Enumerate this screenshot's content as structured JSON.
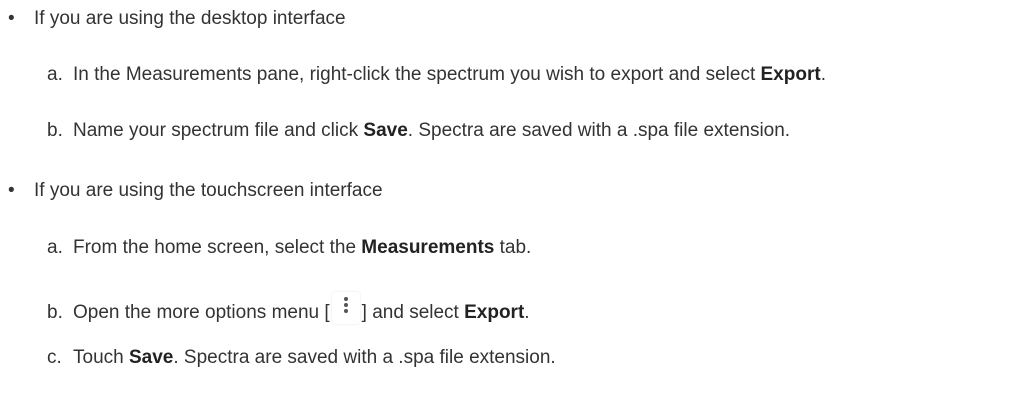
{
  "sections": [
    {
      "bullet": "•",
      "heading": "If you are using the desktop interface",
      "steps": [
        {
          "marker": "a.",
          "pre": "In the Measurements pane, right-click the spectrum you wish to export and select ",
          "bold": "Export",
          "post": "."
        },
        {
          "marker": "b.",
          "pre": "Name your spectrum file and click ",
          "bold": "Save",
          "post": ". Spectra are saved with a .spa file extension."
        }
      ]
    },
    {
      "bullet": "•",
      "heading": "If you are using the touchscreen interface",
      "steps": [
        {
          "marker": "a.",
          "pre": "From the home screen, select the ",
          "bold": "Measurements",
          "post": " tab."
        },
        {
          "marker": "b.",
          "pre": "Open the more options menu [",
          "icon": "more-options-kebab-icon",
          "mid": "] and select ",
          "bold": "Export",
          "post": "."
        },
        {
          "marker": "c.",
          "pre": "Touch ",
          "bold": "Save",
          "post": ". Spectra are saved with a .spa file extension."
        }
      ]
    }
  ]
}
